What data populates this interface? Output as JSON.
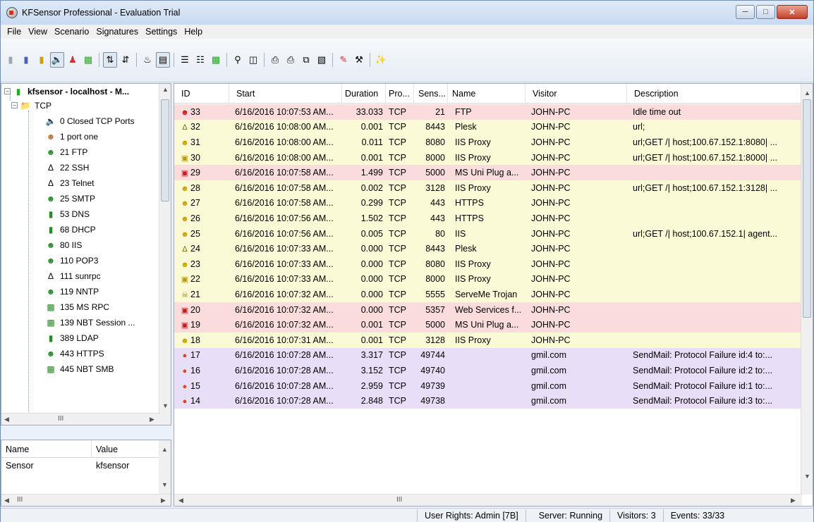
{
  "window": {
    "title": "KFSensor Professional - Evaluation Trial"
  },
  "menu": [
    "File",
    "View",
    "Scenario",
    "Signatures",
    "Settings",
    "Help"
  ],
  "tree": {
    "root": "kfsensor - localhost - M...",
    "group": "TCP",
    "items": [
      "0 Closed TCP Ports",
      "1 port one",
      "21 FTP",
      "22 SSH",
      "23 Telnet",
      "25 SMTP",
      "53 DNS",
      "68 DHCP",
      "80 IIS",
      "110 POP3",
      "111 sunrpc",
      "119 NNTP",
      "135 MS RPC",
      "139 NBT Session ...",
      "389 LDAP",
      "443 HTTPS",
      "445 NBT SMB"
    ],
    "hscroll_mark": "III"
  },
  "props": {
    "headers": [
      "Name",
      "Value"
    ],
    "rows": [
      {
        "name": "Sensor",
        "value": "kfsensor"
      }
    ],
    "hscroll_mark": "III"
  },
  "list": {
    "headers": [
      "ID",
      "Start",
      "Duration",
      "Pro...",
      "Sens...",
      "Name",
      "Visitor",
      "Description"
    ],
    "rows": [
      {
        "id": "33",
        "start": "6/16/2016 10:07:53 AM...",
        "duration": "33.033",
        "proto": "TCP",
        "sensor": "21",
        "name": "FTP",
        "visitor": "JOHN-PC",
        "desc": "Idle time out",
        "color": "red",
        "icon": "red"
      },
      {
        "id": "32",
        "start": "6/16/2016 10:08:00 AM...",
        "duration": "0.001",
        "proto": "TCP",
        "sensor": "8443",
        "name": "Plesk",
        "visitor": "JOHN-PC",
        "desc": "url;",
        "color": "yellow",
        "icon": "tux"
      },
      {
        "id": "31",
        "start": "6/16/2016 10:08:00 AM...",
        "duration": "0.011",
        "proto": "TCP",
        "sensor": "8080",
        "name": "IIS Proxy",
        "visitor": "JOHN-PC",
        "desc": "url;GET /| host;100.67.152.1:8080| ...",
        "color": "yellow",
        "icon": "yellow"
      },
      {
        "id": "30",
        "start": "6/16/2016 10:08:00 AM...",
        "duration": "0.001",
        "proto": "TCP",
        "sensor": "8000",
        "name": "IIS Proxy",
        "visitor": "JOHN-PC",
        "desc": "url;GET /| host;100.67.152.1:8000| ...",
        "color": "yellow",
        "icon": "monitor-yellow"
      },
      {
        "id": "29",
        "start": "6/16/2016 10:07:58 AM...",
        "duration": "1.499",
        "proto": "TCP",
        "sensor": "5000",
        "name": "MS Uni Plug a...",
        "visitor": "JOHN-PC",
        "desc": "",
        "color": "red",
        "icon": "monitor-red"
      },
      {
        "id": "28",
        "start": "6/16/2016 10:07:58 AM...",
        "duration": "0.002",
        "proto": "TCP",
        "sensor": "3128",
        "name": "IIS Proxy",
        "visitor": "JOHN-PC",
        "desc": "url;GET /| host;100.67.152.1:3128| ...",
        "color": "yellow",
        "icon": "yellow"
      },
      {
        "id": "27",
        "start": "6/16/2016 10:07:58 AM...",
        "duration": "0.299",
        "proto": "TCP",
        "sensor": "443",
        "name": "HTTPS",
        "visitor": "JOHN-PC",
        "desc": "",
        "color": "yellow",
        "icon": "yellow"
      },
      {
        "id": "26",
        "start": "6/16/2016 10:07:56 AM...",
        "duration": "1.502",
        "proto": "TCP",
        "sensor": "443",
        "name": "HTTPS",
        "visitor": "JOHN-PC",
        "desc": "",
        "color": "yellow",
        "icon": "yellow"
      },
      {
        "id": "25",
        "start": "6/16/2016 10:07:56 AM...",
        "duration": "0.005",
        "proto": "TCP",
        "sensor": "80",
        "name": "IIS",
        "visitor": "JOHN-PC",
        "desc": "url;GET /| host;100.67.152.1| agent...",
        "color": "yellow",
        "icon": "yellow"
      },
      {
        "id": "24",
        "start": "6/16/2016 10:07:33 AM...",
        "duration": "0.000",
        "proto": "TCP",
        "sensor": "8443",
        "name": "Plesk",
        "visitor": "JOHN-PC",
        "desc": "",
        "color": "yellow",
        "icon": "tux"
      },
      {
        "id": "23",
        "start": "6/16/2016 10:07:33 AM...",
        "duration": "0.000",
        "proto": "TCP",
        "sensor": "8080",
        "name": "IIS Proxy",
        "visitor": "JOHN-PC",
        "desc": "",
        "color": "yellow",
        "icon": "yellow"
      },
      {
        "id": "22",
        "start": "6/16/2016 10:07:33 AM...",
        "duration": "0.000",
        "proto": "TCP",
        "sensor": "8000",
        "name": "IIS Proxy",
        "visitor": "JOHN-PC",
        "desc": "",
        "color": "yellow",
        "icon": "monitor-yellow"
      },
      {
        "id": "21",
        "start": "6/16/2016 10:07:32 AM...",
        "duration": "0.000",
        "proto": "TCP",
        "sensor": "5555",
        "name": "ServeMe Trojan",
        "visitor": "JOHN-PC",
        "desc": "",
        "color": "yellow",
        "icon": "skull"
      },
      {
        "id": "20",
        "start": "6/16/2016 10:07:32 AM...",
        "duration": "0.000",
        "proto": "TCP",
        "sensor": "5357",
        "name": "Web Services f...",
        "visitor": "JOHN-PC",
        "desc": "",
        "color": "red",
        "icon": "monitor-red"
      },
      {
        "id": "19",
        "start": "6/16/2016 10:07:32 AM...",
        "duration": "0.001",
        "proto": "TCP",
        "sensor": "5000",
        "name": "MS Uni Plug a...",
        "visitor": "JOHN-PC",
        "desc": "",
        "color": "red",
        "icon": "monitor-red"
      },
      {
        "id": "18",
        "start": "6/16/2016 10:07:31 AM...",
        "duration": "0.001",
        "proto": "TCP",
        "sensor": "3128",
        "name": "IIS Proxy",
        "visitor": "JOHN-PC",
        "desc": "",
        "color": "yellow",
        "icon": "yellow"
      },
      {
        "id": "17",
        "start": "6/16/2016 10:07:28 AM...",
        "duration": "3.317",
        "proto": "TCP",
        "sensor": "49744",
        "name": "",
        "visitor": "gmil.com",
        "desc": "SendMail: Protocol Failure id:4 to:...",
        "color": "purple",
        "icon": "mail"
      },
      {
        "id": "16",
        "start": "6/16/2016 10:07:28 AM...",
        "duration": "3.152",
        "proto": "TCP",
        "sensor": "49740",
        "name": "",
        "visitor": "gmil.com",
        "desc": "SendMail: Protocol Failure id:2 to:...",
        "color": "purple",
        "icon": "mail"
      },
      {
        "id": "15",
        "start": "6/16/2016 10:07:28 AM...",
        "duration": "2.959",
        "proto": "TCP",
        "sensor": "49739",
        "name": "",
        "visitor": "gmil.com",
        "desc": "SendMail: Protocol Failure id:1 to:...",
        "color": "purple",
        "icon": "mail"
      },
      {
        "id": "14",
        "start": "6/16/2016 10:07:28 AM...",
        "duration": "2.848",
        "proto": "TCP",
        "sensor": "49738",
        "name": "",
        "visitor": "gmil.com",
        "desc": "SendMail: Protocol Failure id:3 to:...",
        "color": "purple",
        "icon": "mail"
      }
    ],
    "hscroll_mark": "III"
  },
  "status": {
    "rights": "User Rights: Admin [7B]",
    "server": "Server: Running",
    "visitors": "Visitors: 3",
    "events": "Events: 33/33"
  },
  "colors": {
    "row_red": "#fbdcdc",
    "row_yellow": "#fbfad6",
    "row_purple": "#e9def8"
  }
}
